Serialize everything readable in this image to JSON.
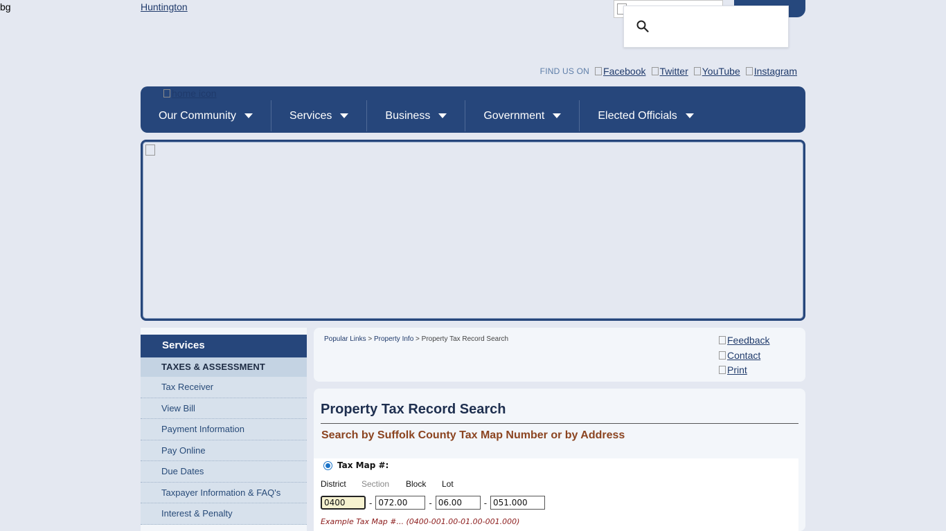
{
  "header": {
    "bg_alt": "bg",
    "logo_alt": "Huntington",
    "find_us_label": "FIND US ON",
    "social": [
      "Facebook",
      "Twitter",
      "YouTube",
      "Instagram"
    ]
  },
  "nav": {
    "home_alt": "home icon",
    "items": [
      "Our Community",
      "Services",
      "Business",
      "Government",
      "Elected Officials"
    ]
  },
  "sidebar": {
    "title": "Services",
    "section": "TAXES & ASSESSMENT",
    "items": [
      "Tax Receiver",
      "View Bill",
      "Payment Information",
      "Pay Online",
      "Due Dates",
      "Taxpayer Information & FAQ's",
      "Interest & Penalty"
    ]
  },
  "breadcrumb": {
    "items": [
      "Popular Links",
      "Property Info"
    ],
    "separator": ">",
    "current": "Property Tax Record Search"
  },
  "tools": [
    "Feedback",
    "Contact",
    "Print"
  ],
  "content": {
    "title": "Property Tax Record Search",
    "subtitle": "Search by Suffolk County Tax Map Number or by Address",
    "radio_label": "Tax Map #:",
    "fields": {
      "district_label": "District",
      "section_label": "Section",
      "block_label": "Block",
      "lot_label": "Lot",
      "district_value": "0400",
      "section_value": "072.00",
      "block_value": "06.00",
      "lot_value": "051.000",
      "dash": "-"
    },
    "example": "Example Tax Map #... (0400-001.00-01.00-001.000)"
  },
  "colors": {
    "nav_bg": "#26467b",
    "page_bg": "#e4e8f1",
    "subtitle": "#8b4420",
    "example": "#8b1a1a"
  }
}
